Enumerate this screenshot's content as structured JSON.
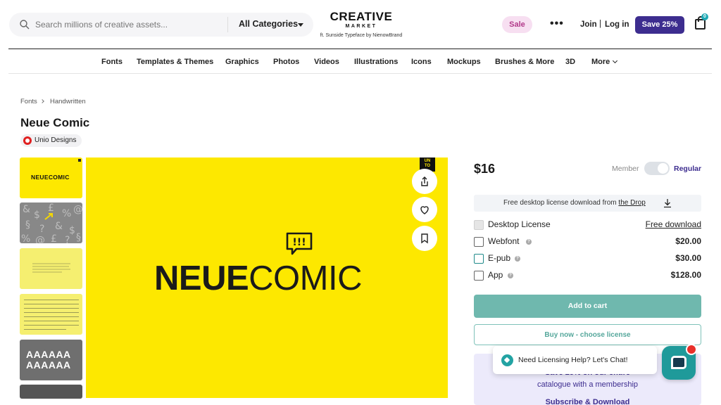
{
  "header": {
    "search_placeholder": "Search millions of creative assets...",
    "category": "All Categories",
    "logo_line1": "CREATIVE",
    "logo_line2": "MARKET",
    "logo_credit": "ft. Sunside Typeface by NienowBrand",
    "sale": "Sale",
    "more_dots": "•••",
    "join": "Join",
    "separator": "|",
    "login": "Log in",
    "save": "Save 25%",
    "cart_count": "0"
  },
  "nav": {
    "items": [
      "Fonts",
      "Templates & Themes",
      "Graphics",
      "Photos",
      "Videos",
      "Illustrations",
      "Icons",
      "Mockups",
      "Brushes & More",
      "3D",
      "More"
    ]
  },
  "breadcrumb": [
    "Fonts",
    "Handwritten"
  ],
  "product": {
    "title": "Neue Comic",
    "author": "Unio Designs"
  },
  "preview": {
    "corner_badge_l1": "UN",
    "corner_badge_l2": "TO",
    "wordmark_bold": "NEUE",
    "wordmark_light": "COMIC",
    "bubble_text": "!!!"
  },
  "thumbnails": {
    "t1_text": "NEUECOMIC",
    "t5_text_l1": "AAAAAA",
    "t5_text_l2": "AAAAAA"
  },
  "pricing": {
    "price": "$16",
    "member_label": "Member",
    "regular_label": "Regular",
    "drop_text": "Free desktop license download from",
    "drop_link": "the Drop",
    "licenses": [
      {
        "name": "Desktop License",
        "value": "Free download"
      },
      {
        "name": "Webfont",
        "value": "$20.00"
      },
      {
        "name": "E-pub",
        "value": "$30.00"
      },
      {
        "name": "App",
        "value": "$128.00"
      }
    ],
    "add_to_cart": "Add to cart",
    "buy_now": "Buy now - choose license"
  },
  "promo": {
    "line1": "Save 25% on our entire",
    "line2": "catalogue with a membership",
    "cta": "Subscribe & Download"
  },
  "chat": {
    "prompt": "Need Licensing Help? Let's Chat!"
  },
  "colors": {
    "brand_purple": "#3d2d8f",
    "accent_teal": "#6fb8ae",
    "preview_yellow": "#fde800",
    "sale_pink": "#f7dff1"
  }
}
